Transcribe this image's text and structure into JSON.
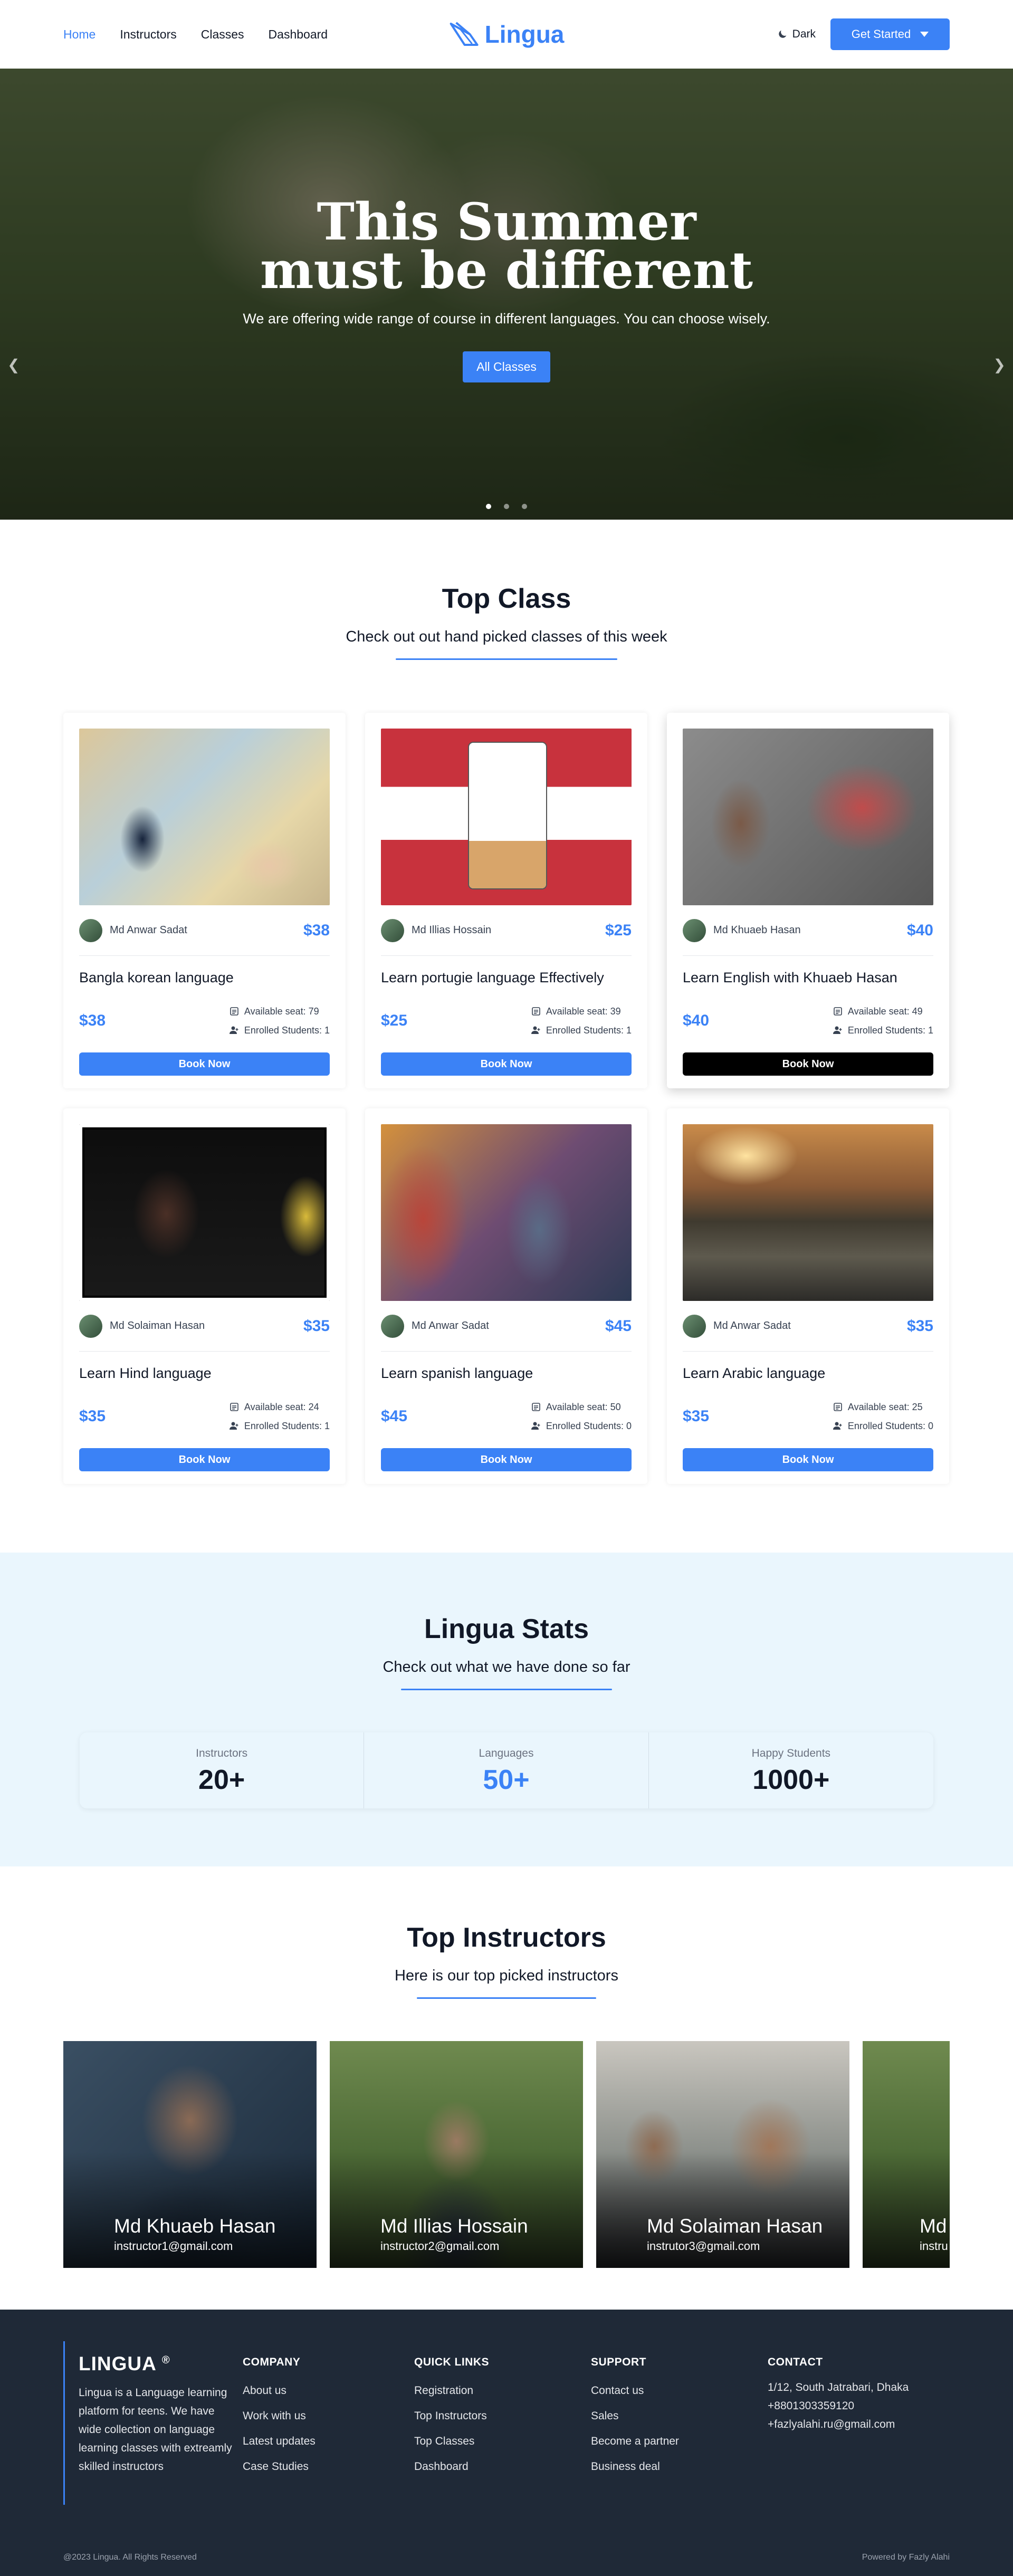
{
  "nav": {
    "links": [
      "Home",
      "Instructors",
      "Classes",
      "Dashboard"
    ],
    "brand": "Lingua",
    "dark_label": "Dark",
    "cta_label": "Get Started"
  },
  "hero": {
    "title_line1": "This Summer",
    "title_line2": "must be different",
    "subtitle": "We are offering wide range of course in different languages. You can choose wisely.",
    "button": "All Classes"
  },
  "top_class": {
    "title": "Top Class",
    "subtitle": "Check out out hand picked classes of this week",
    "cards": [
      {
        "instructor": "Md Anwar Sadat",
        "price": "$38",
        "title": "Bangla korean language",
        "seats": "Available seat: 79",
        "enrolled": "Enrolled Students: 1",
        "button": "Book Now"
      },
      {
        "instructor": "Md Illias Hossain",
        "price": "$25",
        "title": "Learn portugie language Effectively",
        "seats": "Available seat: 39",
        "enrolled": "Enrolled Students: 1",
        "button": "Book Now"
      },
      {
        "instructor": "Md Khuaeb Hasan",
        "price": "$40",
        "title": "Learn English with Khuaeb Hasan",
        "seats": "Available seat: 49",
        "enrolled": "Enrolled Students: 1",
        "button": "Book Now"
      },
      {
        "instructor": "Md Solaiman Hasan",
        "price": "$35",
        "title": "Learn Hind language",
        "seats": "Available seat: 24",
        "enrolled": "Enrolled Students: 1",
        "button": "Book Now"
      },
      {
        "instructor": "Md Anwar Sadat",
        "price": "$45",
        "title": "Learn spanish language",
        "seats": "Available seat: 50",
        "enrolled": "Enrolled Students: 0",
        "button": "Book Now"
      },
      {
        "instructor": "Md Anwar Sadat",
        "price": "$35",
        "title": "Learn Arabic language",
        "seats": "Available seat: 25",
        "enrolled": "Enrolled Students: 0",
        "button": "Book Now"
      }
    ]
  },
  "stats": {
    "title": "Lingua Stats",
    "subtitle": "Check out what we have done so far",
    "items": [
      {
        "label": "Instructors",
        "value": "20+"
      },
      {
        "label": "Languages",
        "value": "50+"
      },
      {
        "label": "Happy Students",
        "value": "1000+"
      }
    ]
  },
  "instructors": {
    "title": "Top Instructors",
    "subtitle": "Here is our top picked instructors",
    "items": [
      {
        "name": "Md Khuaeb Hasan",
        "email": "instructor1@gmail.com"
      },
      {
        "name": "Md Illias Hossain",
        "email": "instructor2@gmail.com"
      },
      {
        "name": "Md Solaiman Hasan",
        "email": "instrutor3@gmail.com"
      },
      {
        "name": "Md",
        "email": "instru"
      }
    ]
  },
  "footer": {
    "brand": "LINGUA",
    "reg": "®",
    "about": "Lingua is a Language learning platform for teens. We have wide collection on language learning classes with extreamly skilled instructors",
    "company": {
      "title": "COMPANY",
      "items": [
        "About us",
        "Work with us",
        "Latest updates",
        "Case Studies"
      ]
    },
    "quick": {
      "title": "QUICK LINKS",
      "items": [
        "Registration",
        "Top Instructors",
        "Top Classes",
        "Dashboard"
      ]
    },
    "support": {
      "title": "SUPPORT",
      "items": [
        "Contact us",
        "Sales",
        "Become a partner",
        "Business deal"
      ]
    },
    "contact": {
      "title": "CONTACT",
      "items": [
        "1/12, South Jatrabari, Dhaka",
        "+8801303359120",
        "+fazlyalahi.ru@gmail.com"
      ]
    },
    "copyright": "@2023 Lingua. All Rights Reserved",
    "powered": "Powered by Fazly Alahi"
  }
}
